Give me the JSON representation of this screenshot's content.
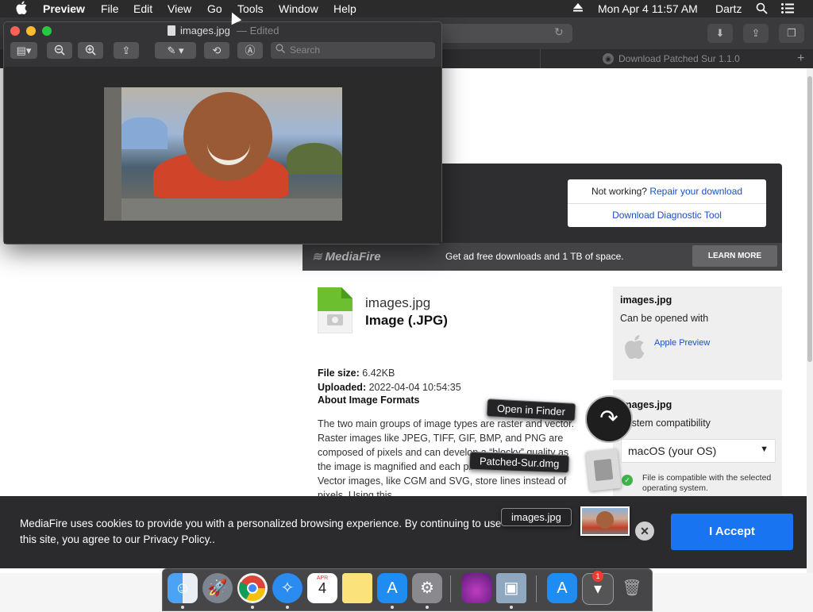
{
  "menubar": {
    "apple_icon": "apple-icon",
    "app_name": "Preview",
    "menus": [
      "File",
      "Edit",
      "View",
      "Go",
      "Tools",
      "Window",
      "Help"
    ],
    "datetime": "Mon Apr 4  11:57 AM",
    "user": "Dartz",
    "status_icons": [
      "eject-icon",
      "search-icon",
      "list-icon"
    ]
  },
  "preview": {
    "title": "images.jpg",
    "edited": "— Edited",
    "search_placeholder": "Search",
    "toolbar_icons": [
      "sidebar-icon",
      "zoom-out-icon",
      "zoom-in-icon",
      "share-icon",
      "markup-pen-icon",
      "rotate-icon",
      "annotate-icon"
    ]
  },
  "browser": {
    "tab_title": "Download Patched Sur 1.1.0",
    "tab_favicon": "mediafire-icon"
  },
  "download": {
    "not_working": "Not working?",
    "repair_link": "Repair your download",
    "diagnostic_link": "Download Diagnostic Tool",
    "mediafire_logo": "MediaFire",
    "promo_text": "Get ad free downloads and 1 TB of space.",
    "learn_more": "LEARN MORE"
  },
  "file": {
    "name": "images.jpg",
    "type": "Image (.JPG)",
    "size_label": "File size:",
    "size": "6.42KB",
    "uploaded_label": "Uploaded:",
    "uploaded": "2022-04-04 10:54:35",
    "about_title": "About Image Formats",
    "about_body": "The two main groups of image types are raster and vector. Raster images like JPEG, TIFF, GIF, BMP, and PNG are composed of pixels and can develop a “blocky” quality as the image is magnified and each pixel becomes larger. Vector images, like CGM and SVG, store lines instead of pixels. Using this"
  },
  "sidebar": {
    "card1_title": "images.jpg",
    "card1_sub": "Can be opened with",
    "app_name": "Apple Preview",
    "card2_title": "images.jpg",
    "card2_sub": "System compatibility",
    "os_selected": "macOS (your OS)",
    "compat_text": "File is compatible with the selected operating system."
  },
  "cookie": {
    "text": "MediaFire uses cookies to provide you with a personalized browsing experience. By continuing to use this site, you agree to our Privacy Policy..",
    "accept": "I Accept"
  },
  "drag_overlay": {
    "open_in_finder": "Open in Finder",
    "patched_sur": "Patched-Sur.dmg",
    "images": "images.jpg"
  },
  "dock": {
    "items": [
      "finder-icon",
      "launchpad-icon",
      "chrome-icon",
      "safari-icon",
      "calendar-icon",
      "notes-icon",
      "app-store-icon",
      "system-preferences-icon",
      "installer-icon",
      "preview-icon",
      "app-store-icon",
      "downloads-icon",
      "trash-icon"
    ],
    "calendar_month": "APR",
    "calendar_day": "4",
    "badge": "1"
  },
  "colors": {
    "accept_button": "#1874f0",
    "link": "#1a4fc4",
    "close_light": "#fe5f57",
    "minimize_light": "#febc2e",
    "maximize_light": "#28c840",
    "badge": "#f23b30"
  }
}
